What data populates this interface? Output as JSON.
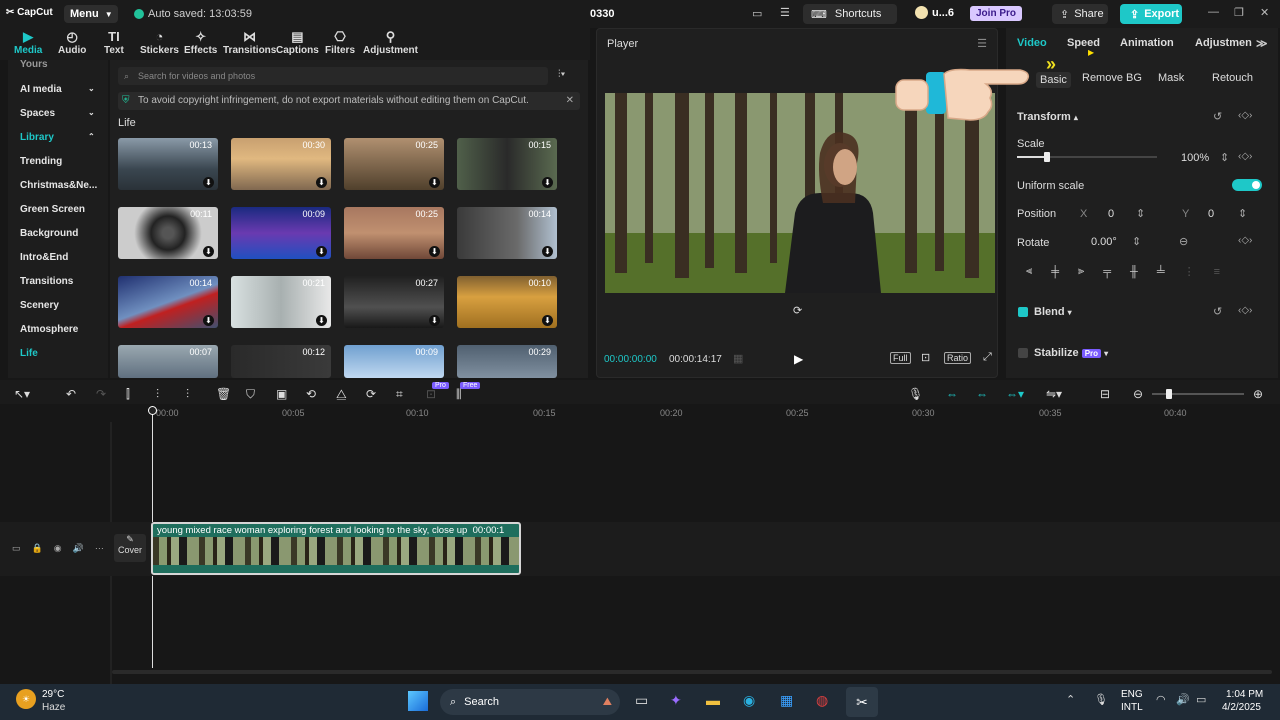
{
  "app": {
    "name": "CapCut",
    "menu": "Menu",
    "autosave": "Auto saved: 13:03:59",
    "project": "0330",
    "shortcuts": "Shortcuts",
    "user": "u...6",
    "join_pro": "Join Pro",
    "share": "Share",
    "export": "Export"
  },
  "media_tabs": [
    {
      "label": "Media",
      "icon": "media-icon"
    },
    {
      "label": "Audio",
      "icon": "audio-icon"
    },
    {
      "label": "Text",
      "icon": "text-icon"
    },
    {
      "label": "Stickers",
      "icon": "stickers-icon"
    },
    {
      "label": "Effects",
      "icon": "effects-icon"
    },
    {
      "label": "Transitions",
      "icon": "transitions-icon"
    },
    {
      "label": "Captions",
      "icon": "captions-icon"
    },
    {
      "label": "Filters",
      "icon": "filters-icon"
    },
    {
      "label": "Adjustment",
      "icon": "adjustment-icon"
    }
  ],
  "sidebar": [
    {
      "label": "Yours"
    },
    {
      "label": "AI media"
    },
    {
      "label": "Spaces"
    },
    {
      "label": "Library"
    },
    {
      "label": "Trending"
    },
    {
      "label": "Christmas&Ne..."
    },
    {
      "label": "Green Screen"
    },
    {
      "label": "Background"
    },
    {
      "label": "Intro&End"
    },
    {
      "label": "Transitions"
    },
    {
      "label": "Scenery"
    },
    {
      "label": "Atmosphere"
    },
    {
      "label": "Life"
    }
  ],
  "library": {
    "search_placeholder": "Search for videos and photos",
    "notice": "To avoid copyright infringement, do not export materials without editing them on CapCut.",
    "section": "Life",
    "durations": [
      "00:13",
      "00:30",
      "00:25",
      "00:15",
      "00:11",
      "00:09",
      "00:25",
      "00:14",
      "00:14",
      "00:21",
      "00:27",
      "00:10",
      "00:07",
      "00:12",
      "00:09",
      "00:29"
    ]
  },
  "player": {
    "title": "Player",
    "current_time": "00:00:00:00",
    "total_time": "00:00:14:17",
    "full": "Full",
    "ratio": "Ratio"
  },
  "right_panel": {
    "tabs": [
      "Video",
      "Speed",
      "Animation",
      "Adjustmen"
    ],
    "sub_tabs": [
      "Basic",
      "Remove BG",
      "Mask",
      "Retouch"
    ],
    "transform": "Transform",
    "scale": "Scale",
    "scale_value": "100%",
    "uniform_scale": "Uniform scale",
    "position": "Position",
    "x_label": "X",
    "x_value": "0",
    "y_label": "Y",
    "y_value": "0",
    "rotate": "Rotate",
    "rotate_value": "0.00°",
    "blend": "Blend",
    "stabilize": "Stabilize",
    "pro": "Pro"
  },
  "timeline": {
    "badges": [
      "Pro",
      "Free"
    ],
    "ruler": [
      "00:00",
      "00:05",
      "00:10",
      "00:15",
      "00:20",
      "00:25",
      "00:30",
      "00:35",
      "00:40"
    ],
    "cover": "Cover",
    "clip_title": "young mixed race woman exploring forest and looking to the sky, close up",
    "clip_time": "00:00:1"
  },
  "taskbar": {
    "temp": "29°C",
    "weather": "Haze",
    "search": "Search",
    "lang1": "ENG",
    "lang2": "INTL",
    "time": "1:04 PM",
    "date": "4/2/2025"
  },
  "colors": {
    "accent": "#1ec8c8",
    "bg": "#171717",
    "panel": "#1f1f1f"
  }
}
